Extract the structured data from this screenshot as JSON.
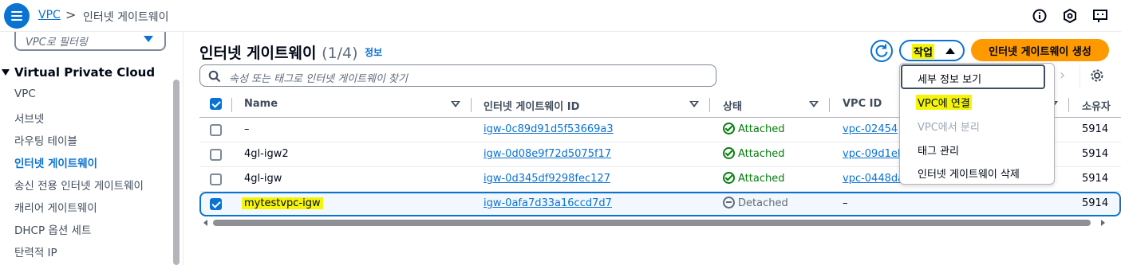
{
  "breadcrumb": {
    "root": "VPC",
    "separator": ">",
    "current": "인터넷 게이트웨이"
  },
  "sidebar": {
    "filter_placeholder": "VPC로 필터링",
    "section_title": "Virtual Private Cloud",
    "items": [
      {
        "label": "VPC"
      },
      {
        "label": "서브넷"
      },
      {
        "label": "라우팅 테이블"
      },
      {
        "label": "인터넷 게이트웨이",
        "active": true
      },
      {
        "label": "송신 전용 인터넷 게이트웨이"
      },
      {
        "label": "캐리어 게이트웨이"
      },
      {
        "label": "DHCP 옵션 세트"
      },
      {
        "label": "탄력적 IP"
      }
    ]
  },
  "main": {
    "title": "인터넷 게이트웨이",
    "count": "(1/4)",
    "info_link": "정보",
    "actions_label": "작업",
    "create_label": "인터넷 게이트웨이 생성",
    "search_placeholder": "속성 또는 태그로 인터넷 게이트웨이 찾기"
  },
  "table": {
    "columns": [
      "Name",
      "인터넷 게이트웨이 ID",
      "상태",
      "VPC ID",
      "소유자"
    ],
    "columns_visible": [
      "Name",
      "인터넷 게이트웨이 ID",
      "상태",
      "VPC ID",
      "소유자"
    ],
    "rows": [
      {
        "name": "–",
        "igw_id": "igw-0c89d91d5f53669a3",
        "status": "Attached",
        "vpc_id": "vpc-02454",
        "owner": "5914",
        "selected": false
      },
      {
        "name": "4gl-igw2",
        "igw_id": "igw-0d08e9f72d5075f17",
        "status": "Attached",
        "vpc_id": "vpc-09d1el",
        "owner": "5914",
        "selected": false
      },
      {
        "name": "4gl-igw",
        "igw_id": "igw-0d345df9298fec127",
        "status": "Attached",
        "vpc_id": "vpc-0448da",
        "owner": "5914",
        "selected": false
      },
      {
        "name": "mytestvpc-igw",
        "igw_id": "igw-0afa7d33a16ccd7d7",
        "status": "Detached",
        "vpc_id": "–",
        "owner": "5914",
        "selected": true
      }
    ]
  },
  "actions_menu": {
    "items": [
      {
        "label": "세부 정보 보기",
        "enabled": true
      },
      {
        "label": "VPC에 연결",
        "enabled": true
      },
      {
        "label": "VPC에서 분리",
        "enabled": false
      },
      {
        "label": "태그 관리",
        "enabled": true
      },
      {
        "label": "인터넷 게이트웨이 삭제",
        "enabled": true
      }
    ]
  },
  "icons": [
    "menu-icon",
    "info-circle-icon",
    "security-hex-icon",
    "feedback-icon",
    "search-icon",
    "refresh-icon",
    "settings-gear-icon",
    "chevron-right-icon",
    "check-circle-icon",
    "minus-circle-icon"
  ],
  "colors": {
    "accent": "#0972d3",
    "primary_button": "#ff9900",
    "success": "#037f0c",
    "highlight": "#f5f50a"
  }
}
